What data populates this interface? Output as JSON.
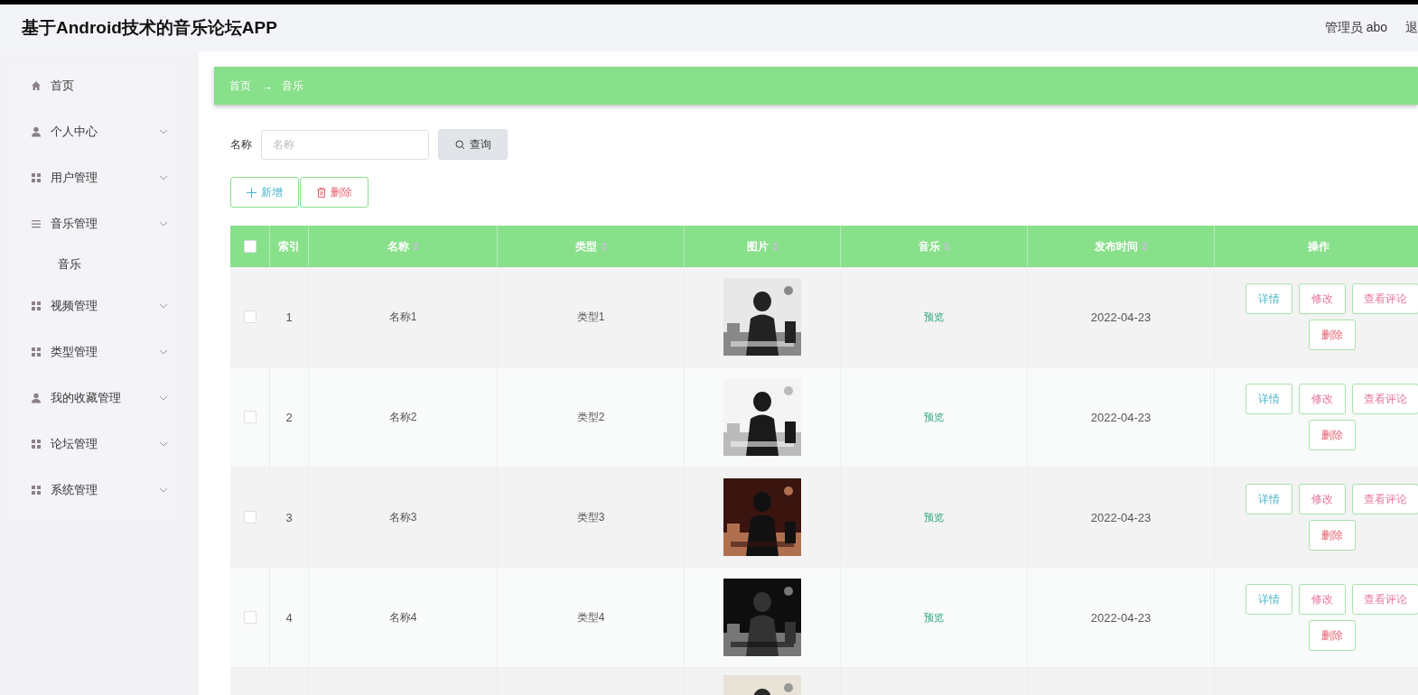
{
  "app_title": "基于Android技术的音乐论坛APP",
  "header": {
    "user": "管理员 abo",
    "logout": "退"
  },
  "sidebar": {
    "items": [
      {
        "kind": "home",
        "label": "首页",
        "expandable": false
      },
      {
        "kind": "user",
        "label": "个人中心",
        "expandable": true
      },
      {
        "kind": "grid",
        "label": "用户管理",
        "expandable": true
      },
      {
        "kind": "list",
        "label": "音乐管理",
        "expandable": true,
        "children": [
          {
            "label": "音乐"
          }
        ]
      },
      {
        "kind": "grid",
        "label": "视频管理",
        "expandable": true
      },
      {
        "kind": "grid",
        "label": "类型管理",
        "expandable": true
      },
      {
        "kind": "user",
        "label": "我的收藏管理",
        "expandable": true
      },
      {
        "kind": "grid",
        "label": "论坛管理",
        "expandable": true
      },
      {
        "kind": "grid",
        "label": "系统管理",
        "expandable": true
      }
    ]
  },
  "breadcrumb": [
    "首页",
    "音乐"
  ],
  "breadcrumb_separator": "→",
  "search": {
    "label": "名称",
    "placeholder": "名称",
    "button": "查询"
  },
  "toolbar": [
    {
      "kind": "add",
      "label": "新增"
    },
    {
      "kind": "delete",
      "label": "删除"
    }
  ],
  "table": {
    "select_all": {
      "checked": false
    },
    "columns": [
      {
        "label": "索引",
        "sortable": false
      },
      {
        "label": "名称",
        "sortable": true
      },
      {
        "label": "类型",
        "sortable": true
      },
      {
        "label": "图片",
        "sortable": true
      },
      {
        "label": "音乐",
        "sortable": true
      },
      {
        "label": "发布时间",
        "sortable": true
      },
      {
        "label": "操作",
        "sortable": false
      }
    ],
    "rows": [
      {
        "checked": false,
        "index": "1",
        "name": "名称1",
        "type": "类型1",
        "music": "预览",
        "date": "2022-04-23",
        "actions": [
          {
            "kind": "detail",
            "label": "详情"
          },
          {
            "kind": "edit",
            "label": "修改"
          },
          {
            "kind": "edit",
            "label": "查看评论"
          },
          {
            "kind": "delete",
            "label": "删除"
          }
        ]
      },
      {
        "checked": false,
        "index": "2",
        "name": "名称2",
        "type": "类型2",
        "music": "预览",
        "date": "2022-04-23",
        "actions": [
          {
            "kind": "detail",
            "label": "详情"
          },
          {
            "kind": "edit",
            "label": "修改"
          },
          {
            "kind": "edit",
            "label": "查看评论"
          },
          {
            "kind": "delete",
            "label": "删除"
          }
        ]
      },
      {
        "checked": false,
        "index": "3",
        "name": "名称3",
        "type": "类型3",
        "music": "预览",
        "date": "2022-04-23",
        "actions": [
          {
            "kind": "detail",
            "label": "详情"
          },
          {
            "kind": "edit",
            "label": "修改"
          },
          {
            "kind": "edit",
            "label": "查看评论"
          },
          {
            "kind": "delete",
            "label": "删除"
          }
        ]
      },
      {
        "checked": false,
        "index": "4",
        "name": "名称4",
        "type": "类型4",
        "music": "预览",
        "date": "2022-04-23",
        "actions": [
          {
            "kind": "detail",
            "label": "详情"
          },
          {
            "kind": "edit",
            "label": "修改"
          },
          {
            "kind": "edit",
            "label": "查看评论"
          },
          {
            "kind": "delete",
            "label": "删除"
          }
        ]
      }
    ]
  }
}
